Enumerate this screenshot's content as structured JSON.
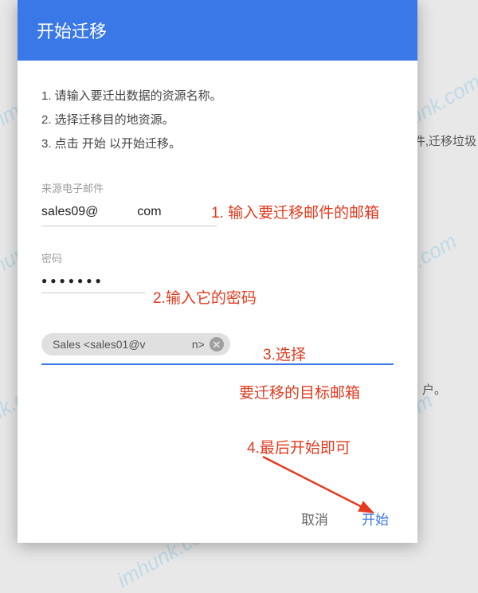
{
  "dialog": {
    "title": "开始迁移",
    "instructions": {
      "line1": "1. 请输入要迁出数据的资源名称。",
      "line2": "2. 选择迁移目的地资源。",
      "line3": "3. 点击 开始 以开始迁移。"
    },
    "source_email": {
      "label": "来源电子邮件",
      "value": "sales09@           com"
    },
    "password": {
      "label": "密码",
      "value": "●●●●●●●"
    },
    "chip": {
      "text": "Sales <sales01@v               n>"
    },
    "actions": {
      "cancel": "取消",
      "start": "开始"
    }
  },
  "annotations": {
    "a1": "1. 输入要迁移邮件的邮箱",
    "a2": "2.输入它的密码",
    "a3": "3.选择",
    "a3b": "要迁移的目标邮箱",
    "a4": "4.最后开始即可"
  },
  "background": {
    "text1": "件,迁移垃圾",
    "text2": "户。"
  },
  "watermark": "imhunk.com"
}
